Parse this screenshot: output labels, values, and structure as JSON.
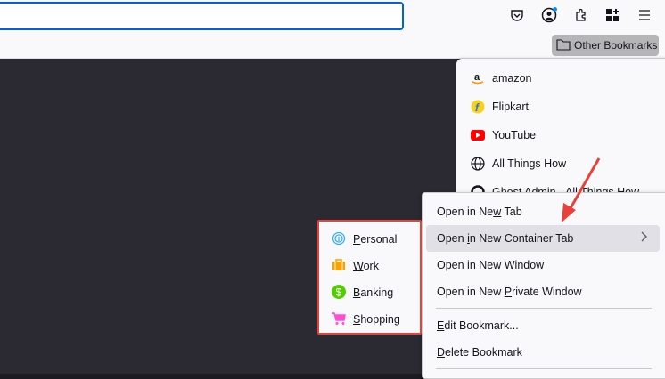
{
  "toolbar": {
    "url_value": "",
    "icons": [
      "pocket-icon",
      "account-icon",
      "extensions-icon",
      "firefox-view-icon",
      "menu-icon"
    ]
  },
  "bookmarks_bar": {
    "other_bookmarks": "Other Bookmarks"
  },
  "bookmarks_panel": {
    "items": [
      {
        "label": "amazon",
        "icon": "amazon-icon"
      },
      {
        "label": "Flipkart",
        "icon": "flipkart-icon"
      },
      {
        "label": "YouTube",
        "icon": "youtube-icon"
      },
      {
        "label": "All Things How",
        "icon": "globe-icon"
      },
      {
        "label": "Ghost Admin - All Things How",
        "icon": "ghost-icon"
      }
    ]
  },
  "context_menu": {
    "open_new_tab": {
      "pre": "Open in Ne",
      "key": "w",
      "post": " Tab"
    },
    "open_container": {
      "pre": "Open ",
      "key": "i",
      "post": "n New Container Tab"
    },
    "open_window": {
      "pre": "Open in ",
      "key": "N",
      "post": "ew Window"
    },
    "open_private": {
      "pre": "Open in New ",
      "key": "P",
      "post": "rivate Window"
    },
    "edit": {
      "key": "E",
      "post": "dit Bookmark..."
    },
    "delete": {
      "key": "D",
      "post": "elete Bookmark"
    }
  },
  "containers": [
    {
      "key": "P",
      "rest": "ersonal",
      "color": "#37adff"
    },
    {
      "key": "W",
      "rest": "ork",
      "color": "#ff9f00"
    },
    {
      "key": "B",
      "rest": "anking",
      "color": "#51cd00"
    },
    {
      "key": "S",
      "rest": "hopping",
      "color": "#ff4bda"
    }
  ],
  "annotation_color": "#e8413a"
}
